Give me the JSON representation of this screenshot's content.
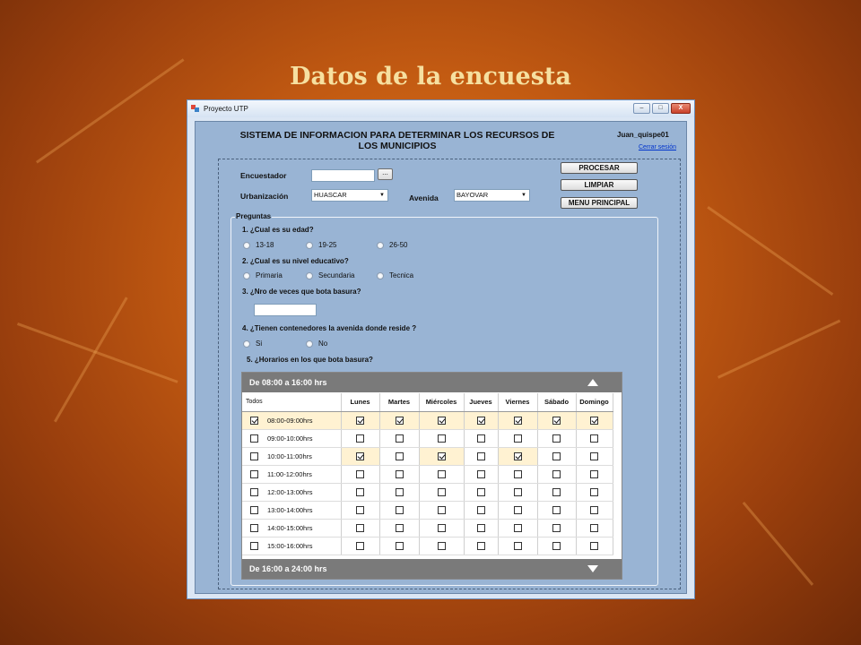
{
  "slide": {
    "title": "Datos de la encuesta"
  },
  "window": {
    "title": "Proyecto UTP",
    "buttons": {
      "minimize": "–",
      "maximize": "□",
      "close": "X"
    }
  },
  "header": {
    "system_title_line1": "SISTEMA DE INFORMACION PARA DETERMINAR LOS RECURSOS DE",
    "system_title_line2": "LOS MUNICIPIOS",
    "user": "Juan_quispe01",
    "logout": "Cerrar sesión"
  },
  "form": {
    "encuestador_label": "Encuestador",
    "encuestador_value": "",
    "browse_button": "...",
    "urbanizacion_label": "Urbanización",
    "urbanizacion_value": "HUASCAR",
    "avenida_label": "Avenida",
    "avenida_value": "BAYOVAR"
  },
  "actions": {
    "procesar": "PROCESAR",
    "limpiar": "LIMPIAR",
    "menu": "MENU PRINCIPAL"
  },
  "preguntas": {
    "title": "Preguntas",
    "q1": "1. ¿Cual es su edad?",
    "q1_options": [
      "13-18",
      "19-25",
      "26-50"
    ],
    "q2": "2. ¿Cual es su nivel educativo?",
    "q2_options": [
      "Primaria",
      "Secundaria",
      "Tecnica"
    ],
    "q3": "3. ¿Nro de veces que bota basura?",
    "q3_value": "",
    "q4": "4. ¿Tienen contenedores la avenida donde reside ?",
    "q4_options": [
      "Si",
      "No"
    ],
    "q5": "5. ¿Horarios en los que bota basura?"
  },
  "schedule": {
    "group1": "De 08:00 a 16:00 hrs",
    "group2": "De 16:00 a 24:00 hrs",
    "all_label": "Todos",
    "days": [
      "Lunes",
      "Martes",
      "Miércoles",
      "Jueves",
      "Viernes",
      "Sábado",
      "Domingo"
    ],
    "rows": [
      {
        "time": "08:00-09:00hrs",
        "row_checked": true,
        "checks": [
          true,
          true,
          true,
          true,
          true,
          true,
          true
        ]
      },
      {
        "time": "09:00-10:00hrs",
        "row_checked": false,
        "checks": [
          false,
          false,
          false,
          false,
          false,
          false,
          false
        ]
      },
      {
        "time": "10:00-11:00hrs",
        "row_checked": false,
        "checks": [
          true,
          false,
          true,
          false,
          true,
          false,
          false
        ]
      },
      {
        "time": "11:00-12:00hrs",
        "row_checked": false,
        "checks": [
          false,
          false,
          false,
          false,
          false,
          false,
          false
        ]
      },
      {
        "time": "12:00-13:00hrs",
        "row_checked": false,
        "checks": [
          false,
          false,
          false,
          false,
          false,
          false,
          false
        ]
      },
      {
        "time": "13:00-14:00hrs",
        "row_checked": false,
        "checks": [
          false,
          false,
          false,
          false,
          false,
          false,
          false
        ]
      },
      {
        "time": "14:00-15:00hrs",
        "row_checked": false,
        "checks": [
          false,
          false,
          false,
          false,
          false,
          false,
          false
        ]
      },
      {
        "time": "15:00-16:00hrs",
        "row_checked": false,
        "checks": [
          false,
          false,
          false,
          false,
          false,
          false,
          false
        ]
      }
    ]
  }
}
